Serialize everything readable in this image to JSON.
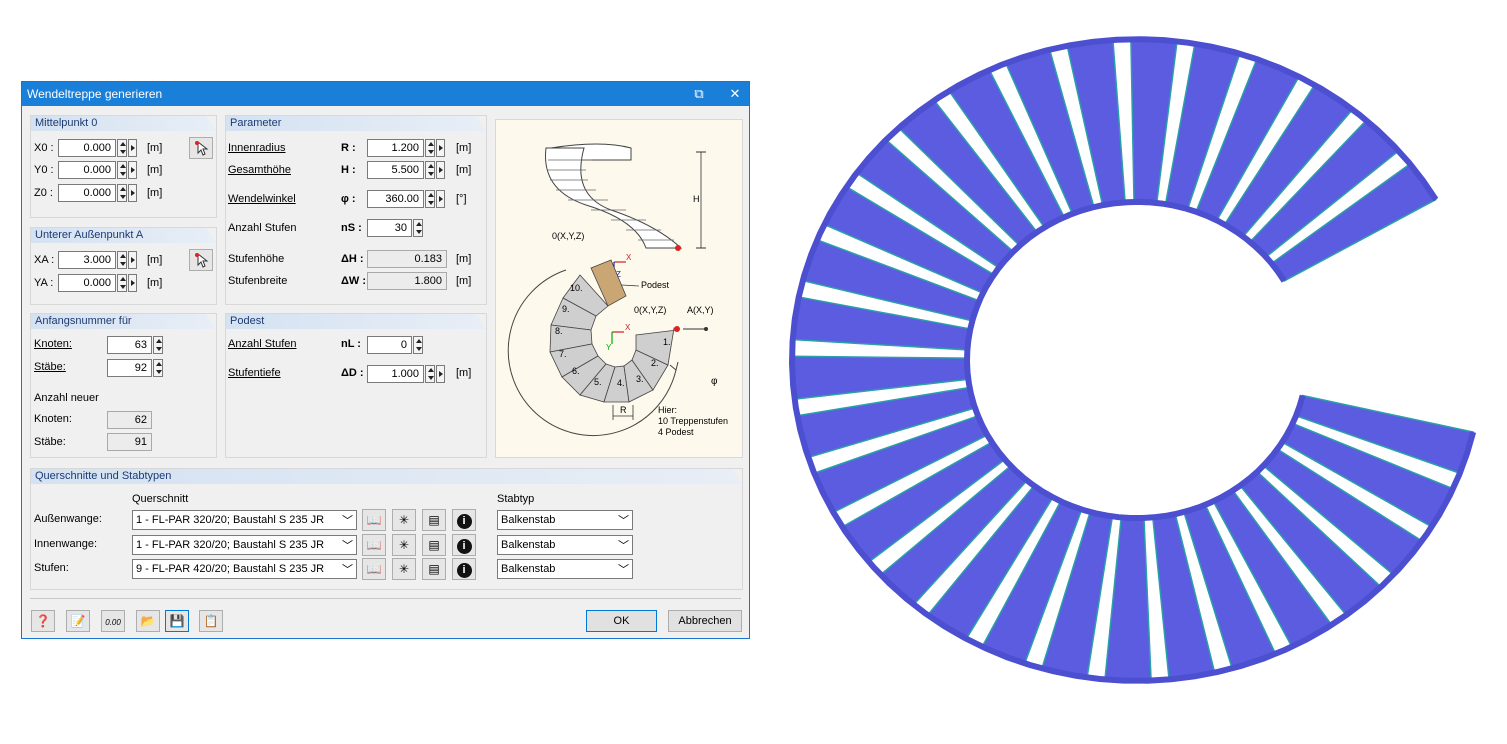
{
  "dialog": {
    "title": "Wendeltreppe generieren",
    "mittelpunkt": {
      "header": "Mittelpunkt 0",
      "fields": [
        {
          "label": "X0 :",
          "value": "0.000",
          "unit": "[m]"
        },
        {
          "label": "Y0 :",
          "value": "0.000",
          "unit": "[m]"
        },
        {
          "label": "Z0 :",
          "value": "0.000",
          "unit": "[m]"
        }
      ]
    },
    "aussenpunkt": {
      "header": "Unterer Außenpunkt A",
      "fields": [
        {
          "label": "XA :",
          "value": "3.000",
          "unit": "[m]"
        },
        {
          "label": "YA :",
          "value": "0.000",
          "unit": "[m]"
        }
      ]
    },
    "anfangsnummer": {
      "header": "Anfangsnummer für",
      "knoten_label": "Knoten:",
      "knoten_value": "63",
      "staebe_label": "Stäbe:",
      "staebe_value": "92",
      "anzahl_neuer": "Anzahl neuer",
      "new_knoten_label": "Knoten:",
      "new_knoten_value": "62",
      "new_staebe_label": "Stäbe:",
      "new_staebe_value": "91"
    },
    "parameter": {
      "header": "Parameter",
      "fields": [
        {
          "label": "Innenradius",
          "symbol": "R :",
          "value": "1.200",
          "unit": "[m]"
        },
        {
          "label": "Gesamthöhe",
          "symbol": "H :",
          "value": "5.500",
          "unit": "[m]"
        },
        {
          "label": "Wendelwinkel",
          "symbol": "φ :",
          "value": "360.00",
          "unit": "[°]"
        },
        {
          "label": "Anzahl Stufen",
          "symbol": "nS :",
          "value": "30",
          "unit": ""
        },
        {
          "label": "Stufenhöhe",
          "symbol": "ΔH :",
          "value": "0.183",
          "unit": "[m]"
        },
        {
          "label": "Stufenbreite",
          "symbol": "ΔW :",
          "value": "1.800",
          "unit": "[m]"
        }
      ]
    },
    "podest": {
      "header": "Podest",
      "fields": [
        {
          "label": "Anzahl Stufen",
          "symbol": "nL :",
          "value": "0",
          "unit": ""
        },
        {
          "label": "Stufentiefe",
          "symbol": "ΔD :",
          "value": "1.000",
          "unit": "[m]"
        }
      ]
    },
    "diagram": {
      "label_o_top": "0(X,Y,Z)",
      "label_o_mid": "0(X,Y,Z)",
      "label_a": "A(X,Y)",
      "label_podest": "Podest",
      "label_h": "H",
      "label_r": "R",
      "label_phi": "φ",
      "label_x": "X",
      "label_z": "Z",
      "label_y": "Y",
      "note_1": "Hier:",
      "note_2": "10 Treppenstufen",
      "note_3": "4 Podest",
      "steps": [
        "1.",
        "2.",
        "3.",
        "4.",
        "5.",
        "6.",
        "7.",
        "8.",
        "9.",
        "10."
      ]
    },
    "querschnitte": {
      "header": "Querschnitte und Stabtypen",
      "col_querschnitt": "Querschnitt",
      "col_stabtyp": "Stabtyp",
      "rows": [
        {
          "label": "Außenwange:",
          "section": "1 - FL-PAR 320/20; Baustahl S 235 JR",
          "stabtyp": "Balkenstab"
        },
        {
          "label": "Innenwange:",
          "section": "1 - FL-PAR 320/20; Baustahl S 235 JR",
          "stabtyp": "Balkenstab"
        },
        {
          "label": "Stufen:",
          "section": "9 - FL-PAR 420/20; Baustahl S 235 JR",
          "stabtyp": "Balkenstab"
        }
      ]
    },
    "buttons": {
      "ok": "OK",
      "cancel": "Abbrechen"
    },
    "colors": {
      "accent": "#1a7fd8",
      "stair_blue": "#5b5ce0",
      "stair_edge": "#2aa0a8"
    }
  },
  "render": {
    "step_count": 30,
    "sweep_degrees": 320
  }
}
